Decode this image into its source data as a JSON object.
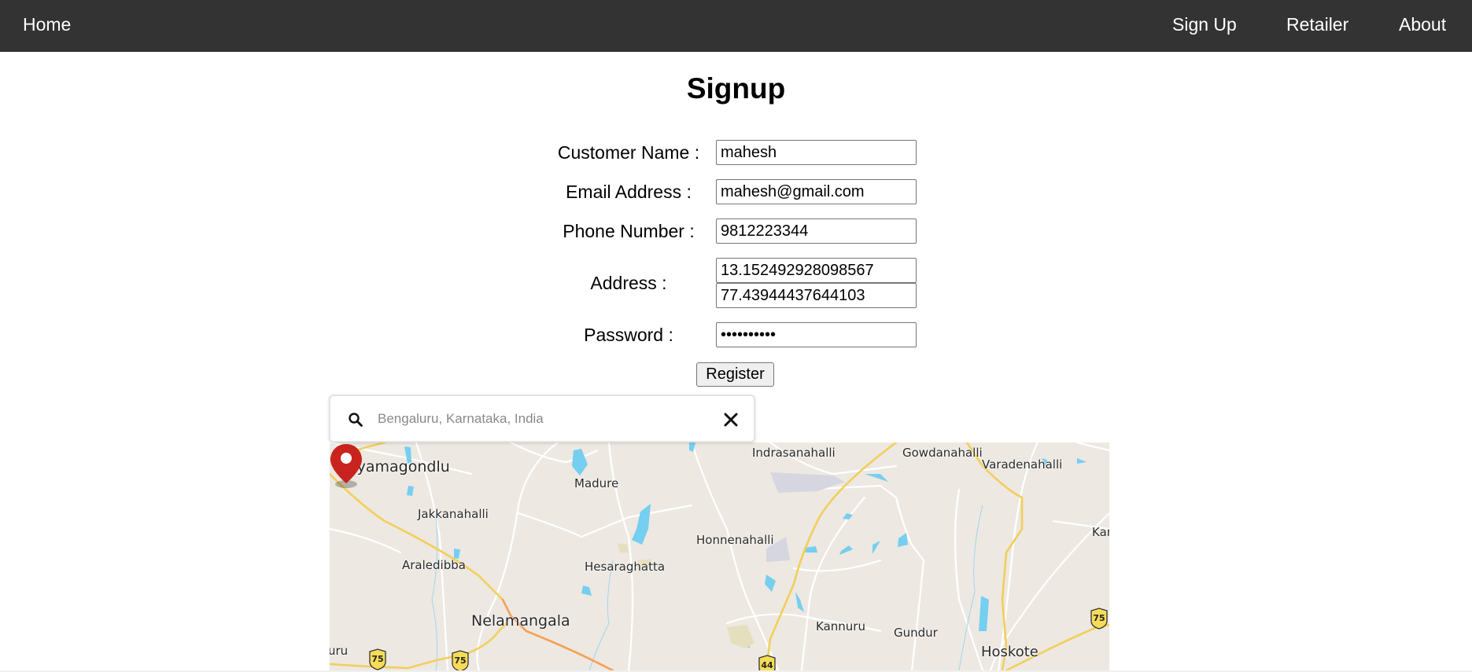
{
  "nav": {
    "home": "Home",
    "links": [
      "Sign Up",
      "Retailer",
      "About"
    ]
  },
  "page": {
    "title": "Signup"
  },
  "form": {
    "customer_name": {
      "label": "Customer Name :",
      "value": "mahesh"
    },
    "email": {
      "label": "Email Address :",
      "value": "mahesh@gmail.com"
    },
    "phone": {
      "label": "Phone Number :",
      "value": "9812223344"
    },
    "address": {
      "label": "Address :",
      "latitude": "13.152492928098567",
      "longitude": "77.43944437644103"
    },
    "password": {
      "label": "Password :",
      "value": "••••••••••"
    },
    "register_label": "Register"
  },
  "map": {
    "search": {
      "placeholder": "Bengaluru, Karnataka, India",
      "value": ""
    },
    "places": {
      "tyamagondlu": "Tyamagondlu",
      "madure": "Madure",
      "jakkanahalli": "Jakkanahalli",
      "araledibba": "Araledibba",
      "hesaraghatta": "Hesaraghatta",
      "nelamangala": "Nelamangala",
      "indrasanahalli": "Indrasanahalli",
      "gowdanahalli": "Gowdanahalli",
      "varadenahalli": "Varadenahalli",
      "honnenahalli": "Honnenahalli",
      "kannuru": "Kannuru",
      "gundur": "Gundur",
      "hoskote": "Hoskote",
      "kar_partial": "Kar",
      "uru_partial": "uru"
    },
    "highway_shields": [
      "75",
      "75",
      "44",
      "75"
    ],
    "colors": {
      "land": "#ede8e2",
      "water": "#75cff0",
      "highway": "#f2cf59",
      "national_highway": "#f7a053",
      "marker": "#c9231f"
    }
  }
}
